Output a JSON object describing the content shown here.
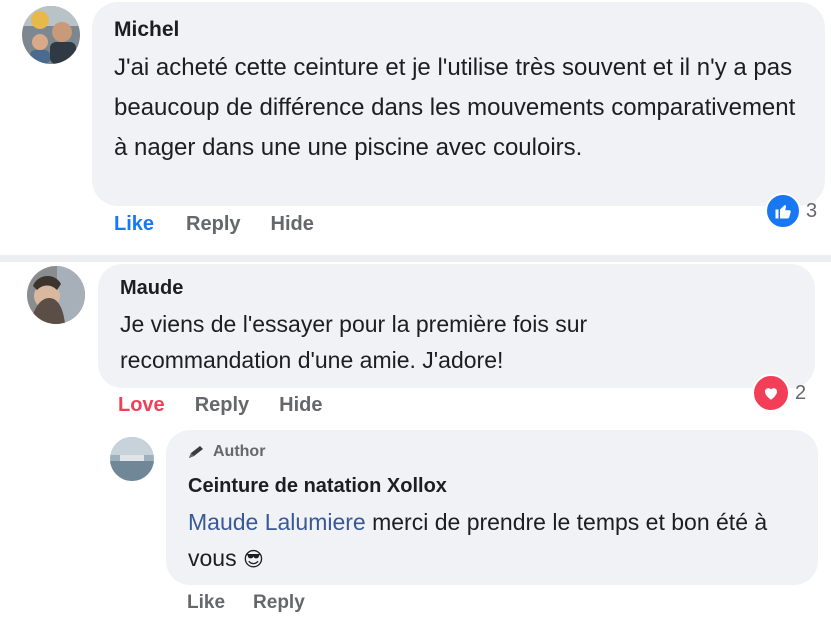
{
  "comments": [
    {
      "author": "Michel",
      "text": "J'ai acheté cette ceinture et je l'utilise très souvent et il n'y a pas beaucoup de différence dans les mouvements comparativement à nager dans une une piscine avec couloirs.",
      "actions": {
        "like": "Like",
        "reply": "Reply",
        "hide": "Hide"
      },
      "reaction": {
        "icon": "like-reaction-icon",
        "count": "3",
        "color": "#1877f2"
      }
    },
    {
      "author": "Maude",
      "text": "Je viens de l'essayer pour la première fois sur recommandation d'une amie. J'adore!",
      "actions": {
        "like": "Love",
        "reply": "Reply",
        "hide": "Hide"
      },
      "reaction": {
        "icon": "love-reaction-icon",
        "count": "2",
        "color": "#f33e58"
      },
      "like_color": "#f33e58"
    }
  ],
  "reply": {
    "badge": "Author",
    "badge_icon": "pencil-icon",
    "author": "Ceinture de natation Xollox",
    "mention": "Maude Lalumiere",
    "text": "merci de prendre le temps et bon été à vous",
    "emoji": "😎",
    "actions": {
      "like": "Like",
      "reply": "Reply"
    }
  },
  "colors": {
    "link_blue": "#1877f2",
    "mention_blue": "#385898",
    "bubble": "#f0f2f5"
  }
}
